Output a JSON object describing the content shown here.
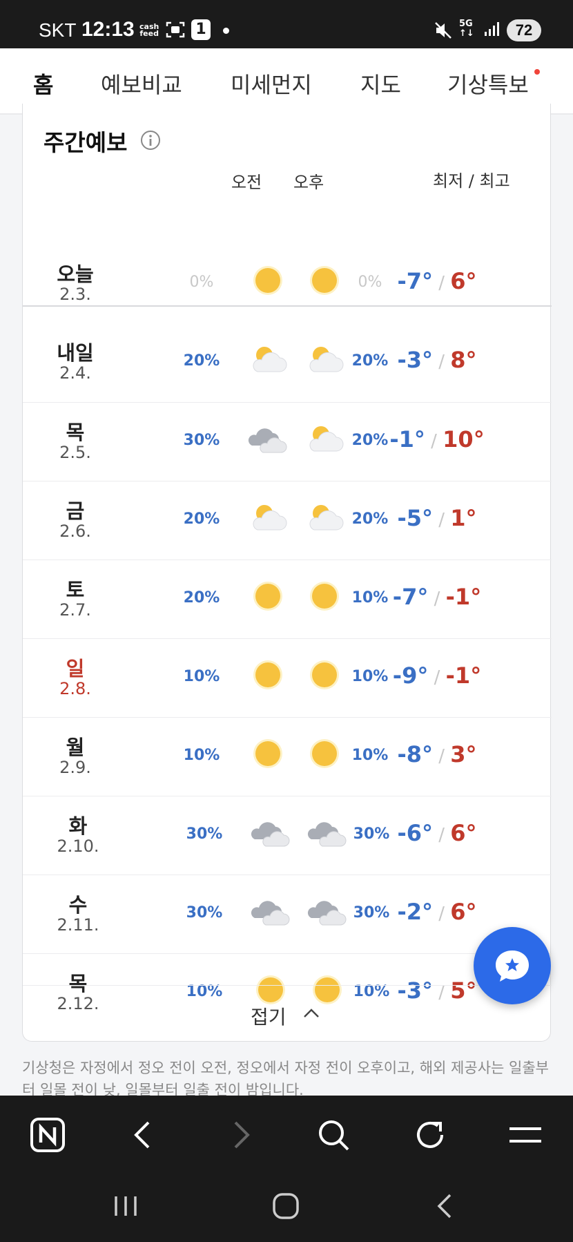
{
  "status_bar": {
    "carrier": "SKT",
    "time": "12:13",
    "cashfeed": "cash feed",
    "notification_count": "1",
    "network": "5G",
    "battery": "72"
  },
  "tabs": [
    {
      "label": "홈",
      "active": true
    },
    {
      "label": "예보비교",
      "active": false
    },
    {
      "label": "미세먼지",
      "active": false
    },
    {
      "label": "지도",
      "active": false
    },
    {
      "label": "기상특보",
      "active": false,
      "dot": true
    }
  ],
  "weekly": {
    "title": "주간예보",
    "col_am": "오전",
    "col_pm": "오후",
    "col_lohi": "최저 / 최고",
    "rows": [
      {
        "day": "오늘",
        "date": "2.3.",
        "am_pct": "0%",
        "am_icon": "sunny",
        "pm_icon": "sunny",
        "pm_pct": "0%",
        "low": "-7°",
        "high": "6°",
        "faint": true
      },
      {
        "day": "내일",
        "date": "2.4.",
        "am_pct": "20%",
        "am_icon": "partly-cloudy",
        "pm_icon": "partly-cloudy",
        "pm_pct": "20%",
        "low": "-3°",
        "high": "8°"
      },
      {
        "day": "목",
        "date": "2.5.",
        "am_pct": "30%",
        "am_icon": "cloudy",
        "pm_icon": "partly-cloudy",
        "pm_pct": "20%",
        "low": "-1°",
        "high": "10°"
      },
      {
        "day": "금",
        "date": "2.6.",
        "am_pct": "20%",
        "am_icon": "partly-cloudy",
        "pm_icon": "partly-cloudy",
        "pm_pct": "20%",
        "low": "-5°",
        "high": "1°"
      },
      {
        "day": "토",
        "date": "2.7.",
        "am_pct": "20%",
        "am_icon": "sunny",
        "pm_icon": "sunny",
        "pm_pct": "10%",
        "low": "-7°",
        "high": "-1°"
      },
      {
        "day": "일",
        "date": "2.8.",
        "am_pct": "10%",
        "am_icon": "sunny",
        "pm_icon": "sunny",
        "pm_pct": "10%",
        "low": "-9°",
        "high": "-1°",
        "sunday": true
      },
      {
        "day": "월",
        "date": "2.9.",
        "am_pct": "10%",
        "am_icon": "sunny",
        "pm_icon": "sunny",
        "pm_pct": "10%",
        "low": "-8°",
        "high": "3°"
      },
      {
        "day": "화",
        "date": "2.10.",
        "am_pct": "30%",
        "am_icon": "cloudy",
        "pm_icon": "cloudy",
        "pm_pct": "30%",
        "low": "-6°",
        "high": "6°"
      },
      {
        "day": "수",
        "date": "2.11.",
        "am_pct": "30%",
        "am_icon": "cloudy",
        "pm_icon": "cloudy",
        "pm_pct": "30%",
        "low": "-2°",
        "high": "6°"
      },
      {
        "day": "목",
        "date": "2.12.",
        "am_pct": "10%",
        "am_icon": "sunny",
        "pm_icon": "sunny",
        "pm_pct": "10%",
        "low": "-3°",
        "high": "5°"
      }
    ],
    "fold_label": "접기"
  },
  "footnote": "기상청은 자정에서 정오 전이 오전, 정오에서 자정 전이 오후이고, 해외 제공사는 일출부터 일몰 전이 낮, 일몰부터 일출 전이 밤입니다.",
  "colors": {
    "low_temp": "#3a6fc4",
    "high_temp": "#c0392b",
    "fab": "#2c6ae8",
    "sun": "#f6c23e"
  }
}
